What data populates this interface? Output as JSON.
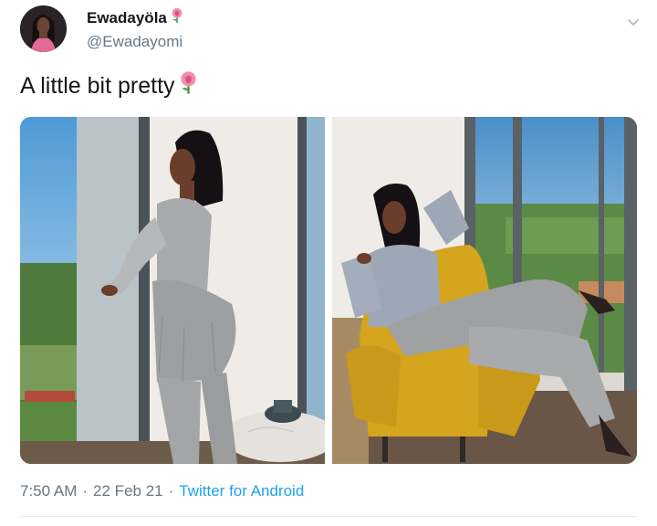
{
  "tweet": {
    "display_name": "Ewadayöla",
    "name_emoji_icon": "rose-icon",
    "handle": "@Ewadayomi",
    "text": "A little bit pretty",
    "text_emoji_icon": "rose-icon",
    "time": "7:50 AM",
    "separator": "·",
    "date": "22 Feb 21",
    "source": "Twitter for Android",
    "media_count": 2
  },
  "colors": {
    "text_primary": "#14171a",
    "text_secondary": "#657786",
    "link": "#1da1f2",
    "divider": "#e1e8ed"
  }
}
